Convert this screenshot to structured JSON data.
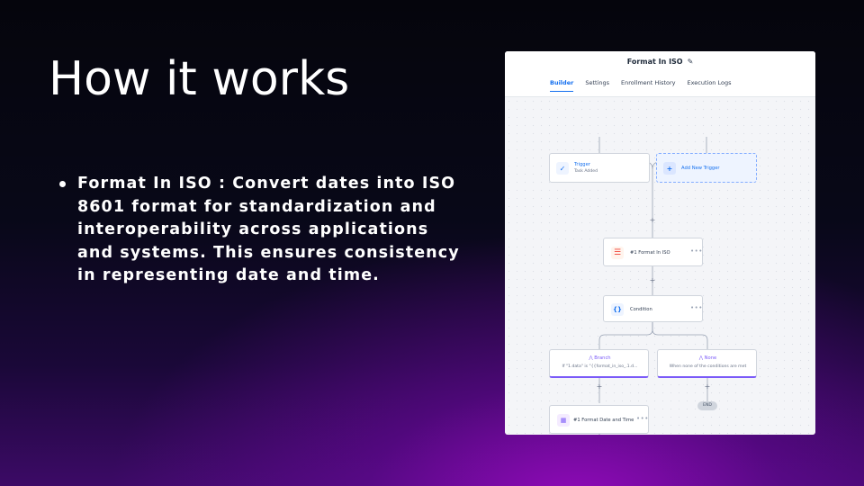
{
  "slide": {
    "title": "How it works",
    "bullets": [
      {
        "text": "Format In ISO : Convert dates into ISO 8601 format for standardization and interoperability across applications and systems. This ensures consistency in representing date and time."
      }
    ]
  },
  "workflow": {
    "title": "Format In ISO",
    "tabs": [
      {
        "label": "Builder",
        "active": true
      },
      {
        "label": "Settings",
        "active": false
      },
      {
        "label": "Enrollment History",
        "active": false
      },
      {
        "label": "Execution Logs",
        "active": false
      }
    ],
    "trigger": {
      "title": "Trigger",
      "subtitle": "Task Added"
    },
    "add_trigger_label": "Add New Trigger",
    "action_format_iso": "#1 Format In ISO",
    "condition_label": "Condition",
    "branch": {
      "title": "Branch",
      "subtitle": "If \"1.data\" is \"{{format_in_iso_.1.d..."
    },
    "none_branch": {
      "title": "None",
      "subtitle": "When none of the conditions are met"
    },
    "action_format_date": "#1 Format Date and Time",
    "end_label": "END",
    "plus_label": "+",
    "more_label": "•••",
    "colors": {
      "accent": "#1570ef",
      "branch": "#7a5af8",
      "iso_icon": "#f04438"
    },
    "icons": [
      "pencil-icon",
      "check-icon",
      "plus-icon",
      "iso-format-icon",
      "braces-icon",
      "branch-icon",
      "calendar-icon",
      "more-icon"
    ]
  }
}
